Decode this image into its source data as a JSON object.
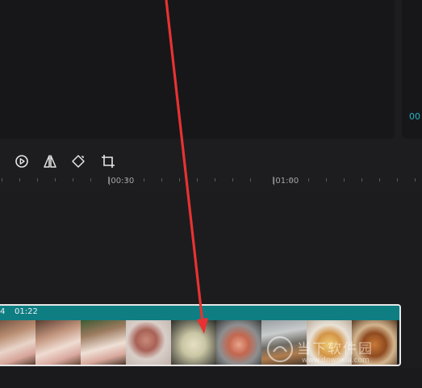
{
  "preview": {
    "right_timecode": "00"
  },
  "toolbar": {
    "icons": [
      "play-circle-icon",
      "mirror-icon",
      "rotate-icon",
      "crop-icon"
    ]
  },
  "ruler": {
    "labels": [
      "|00:30",
      "|01:00"
    ]
  },
  "clip": {
    "left_text": "4",
    "duration": "01:22",
    "header_color": "#0e7e83"
  },
  "watermark": {
    "text": "当下软件园",
    "url": "www.downxia.com"
  },
  "annotation": {
    "arrow_color": "#e83232"
  }
}
